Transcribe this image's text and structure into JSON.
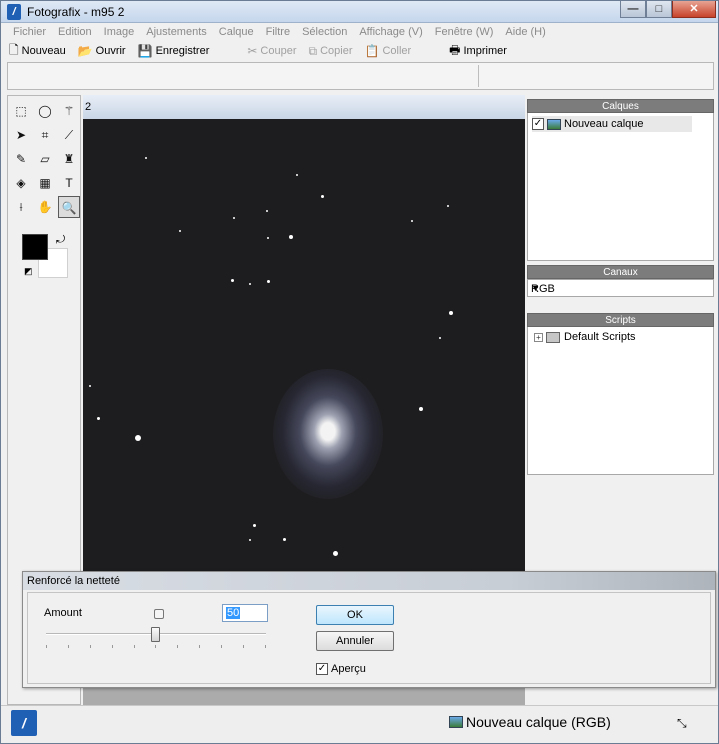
{
  "window": {
    "title": "Fotografix - m95 2",
    "controls": {
      "minimize": "—",
      "maximize": "□",
      "close": "✕"
    }
  },
  "menu": [
    "Fichier",
    "Edition",
    "Image",
    "Ajustements",
    "Calque",
    "Filtre",
    "Sélection",
    "Affichage (V)",
    "Fenêtre (W)",
    "Aide (H)"
  ],
  "toolbar": {
    "new": "Nouveau",
    "open": "Ouvrir",
    "save": "Enregistrer",
    "cut": "Couper",
    "copy": "Copier",
    "paste": "Coller",
    "print": "Imprimer"
  },
  "document": {
    "title": "2"
  },
  "panels": {
    "layers": {
      "header": "Calques",
      "items": [
        {
          "name": "Nouveau calque",
          "visible": true
        }
      ]
    },
    "channels": {
      "header": "Canaux",
      "selected": "RGB"
    },
    "scripts": {
      "header": "Scripts",
      "items": [
        {
          "name": "Default Scripts",
          "expander": "+"
        }
      ]
    }
  },
  "dialog": {
    "title": "Renforcé la netteté",
    "amount_label": "Amount",
    "amount_value": "50",
    "slider_fraction": 0.5,
    "ok_label": "OK",
    "cancel_label": "Annuler",
    "preview_label": "Aperçu",
    "preview_checked": true
  },
  "status": {
    "text": "Nouveau calque (RGB)"
  },
  "colors": {
    "foreground": "#000000",
    "background": "#ffffff"
  }
}
